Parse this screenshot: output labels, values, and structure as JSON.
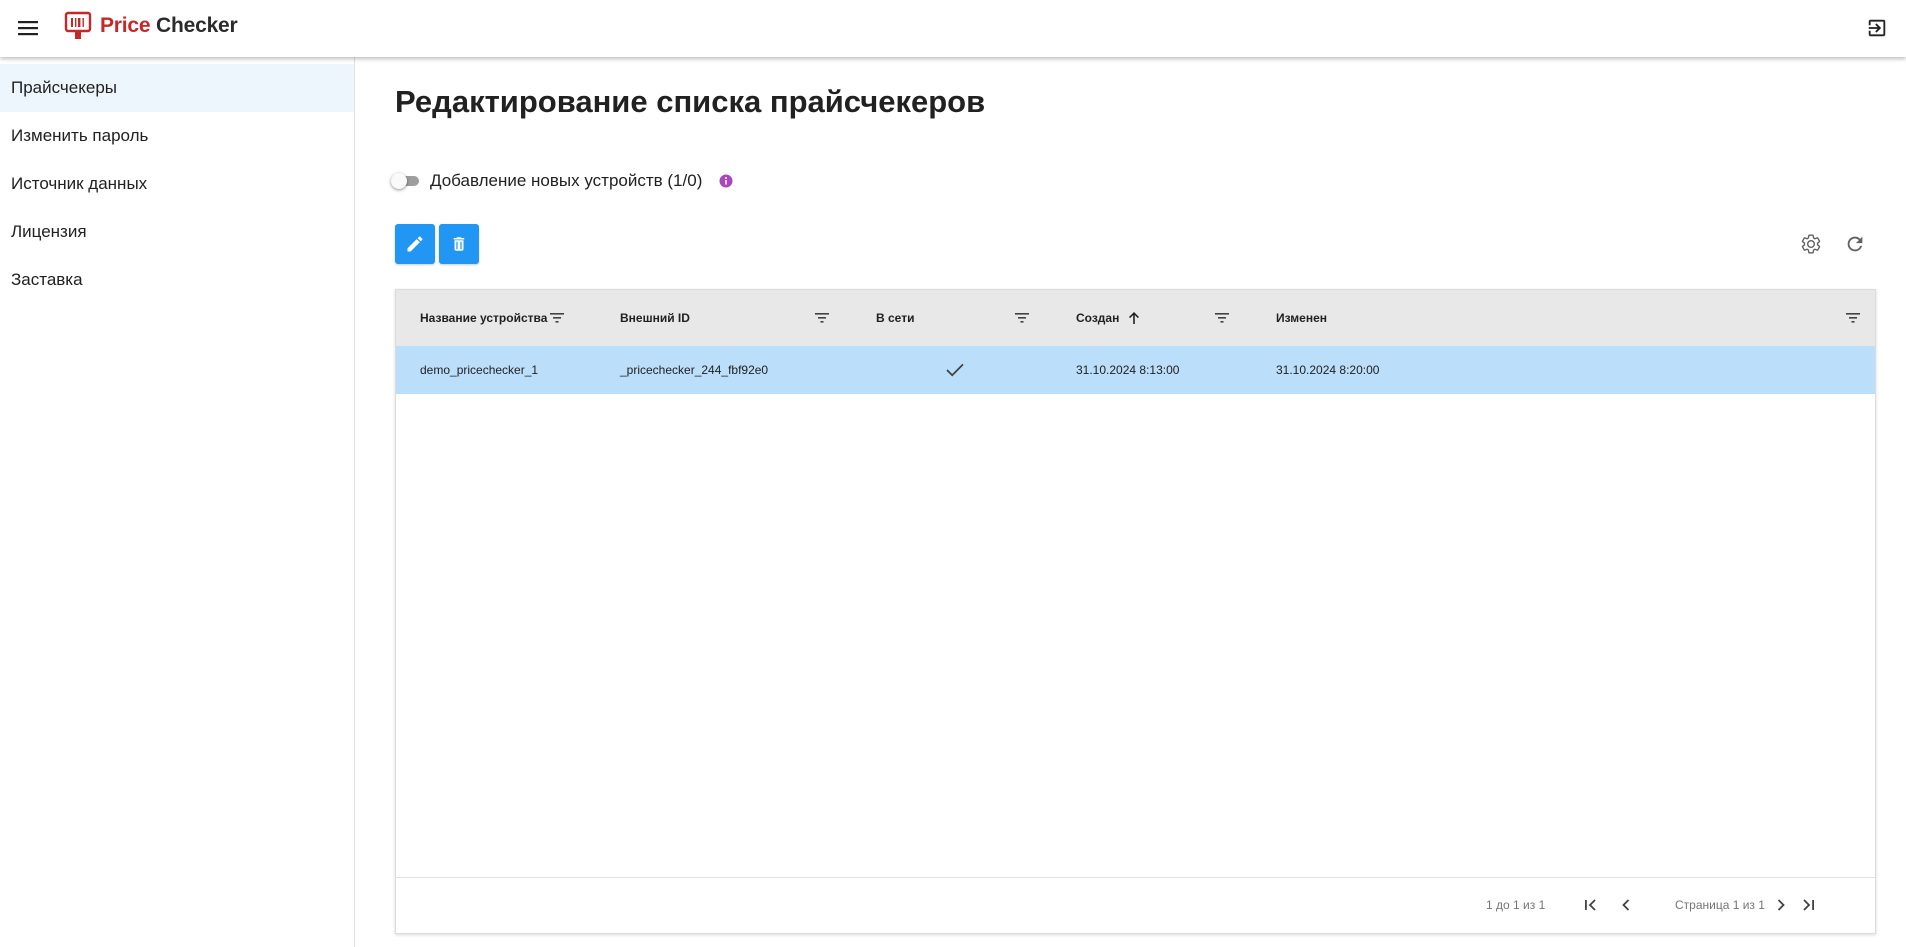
{
  "app": {
    "logo_price": "Price",
    "logo_checker": "Checker",
    "brand_color": "#c62828"
  },
  "sidebar": {
    "items": [
      {
        "label": "Прайсчекеры",
        "active": true
      },
      {
        "label": "Изменить пароль"
      },
      {
        "label": "Источник данных"
      },
      {
        "label": "Лицензия"
      },
      {
        "label": "Заставка"
      }
    ]
  },
  "page": {
    "title": "Редактирование списка прайсчекеров",
    "toggle_label": "Добавление новых устройств (1/0)",
    "toggle_on": false,
    "accent": "#2196f3",
    "info_color": "#ab47bc"
  },
  "grid": {
    "columns": [
      {
        "label": "Название устройства",
        "sort": ""
      },
      {
        "label": "Внешний ID",
        "sort": ""
      },
      {
        "label": "В сети",
        "sort": ""
      },
      {
        "label": "Создан",
        "sort": "asc"
      },
      {
        "label": "Изменен",
        "sort": ""
      }
    ],
    "rows": [
      {
        "name": "demo_pricechecker_1",
        "external_id": "_pricechecker_244_fbf92e0",
        "online": true,
        "created": "31.10.2024 8:13:00",
        "modified": "31.10.2024 8:20:00"
      }
    ],
    "selected_row_color": "#bbdefb",
    "pager_summary": "1 до 1 из 1",
    "pager_page": "Страница 1 из 1"
  }
}
